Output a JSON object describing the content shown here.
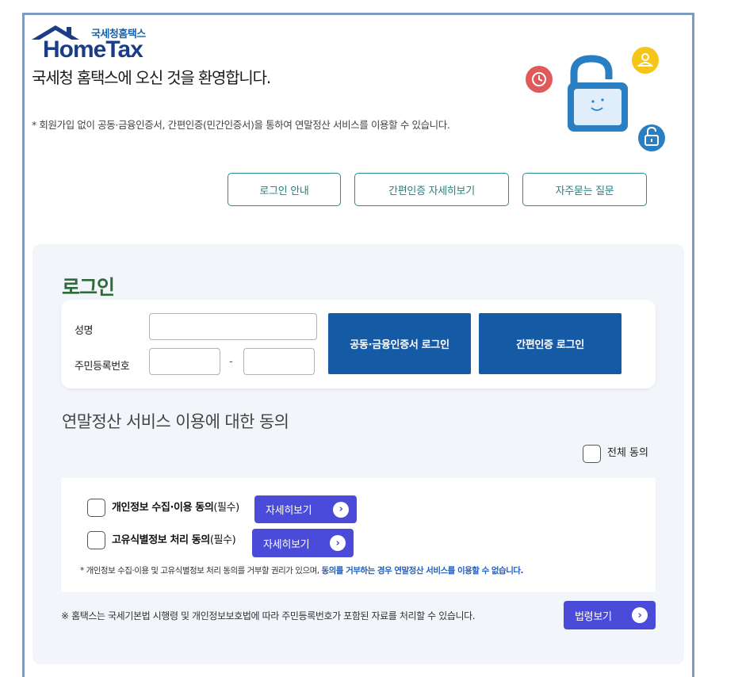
{
  "header": {
    "logo_sub": "국세청홈택스",
    "logo_main": "HomeTax",
    "welcome": "국세청 홈택스에 오신 것을 환영합니다.",
    "notice": "* 회원가입 없이 공동·금융인증서, 간편인증(민간인증서)을 통하여 연말정산 서비스를 이용할 수 있습니다."
  },
  "top_buttons": {
    "login_guide": "로그인 안내",
    "simple_auth_detail": "간편인증 자세히보기",
    "faq": "자주묻는 질문"
  },
  "login": {
    "title": "로그인",
    "name_label": "성명",
    "rrn_label": "주민등록번호",
    "rrn_separator": "-",
    "name_value": "",
    "rrn_front_value": "",
    "rrn_back_value": "",
    "cert_login_button": "공동·금융인증서 로그인",
    "simple_login_button": "간편인증 로그인"
  },
  "consent": {
    "title": "연말정산 서비스 이용에 대한 동의",
    "all_agree": "전체 동의",
    "items": [
      {
        "label": "개인정보 수집·이용 동의",
        "required": "(필수)",
        "button": "자세히보기"
      },
      {
        "label": "고유식별정보 처리 동의",
        "required": "(필수)",
        "button": "자세히보기"
      }
    ],
    "note_prefix": "* 개인정보 수집·이용 및 고유식별정보 처리 동의를 거부할 권리가 있으며, ",
    "note_highlight": "동의를 거부하는 경우 연말정산 서비스를 이용할 수 없습니다.",
    "bottom_note": "※ 홈택스는 국세기본법 시행령 및 개인정보보호법에 따라 주민등록번호가 포함된 자료를 처리할 수 있습니다.",
    "law_button": "법령보기"
  },
  "colors": {
    "frame_border": "#7f9bbd",
    "teal_accent": "#2a8c8c",
    "login_blue": "#155aa5",
    "purple_button": "#4a4bd8",
    "login_title_green": "#2e6a3a"
  },
  "icons": [
    "house-roof-icon",
    "clock-icon",
    "padlock-icon",
    "user-icon",
    "unlock-icon",
    "chevron-right-icon"
  ]
}
